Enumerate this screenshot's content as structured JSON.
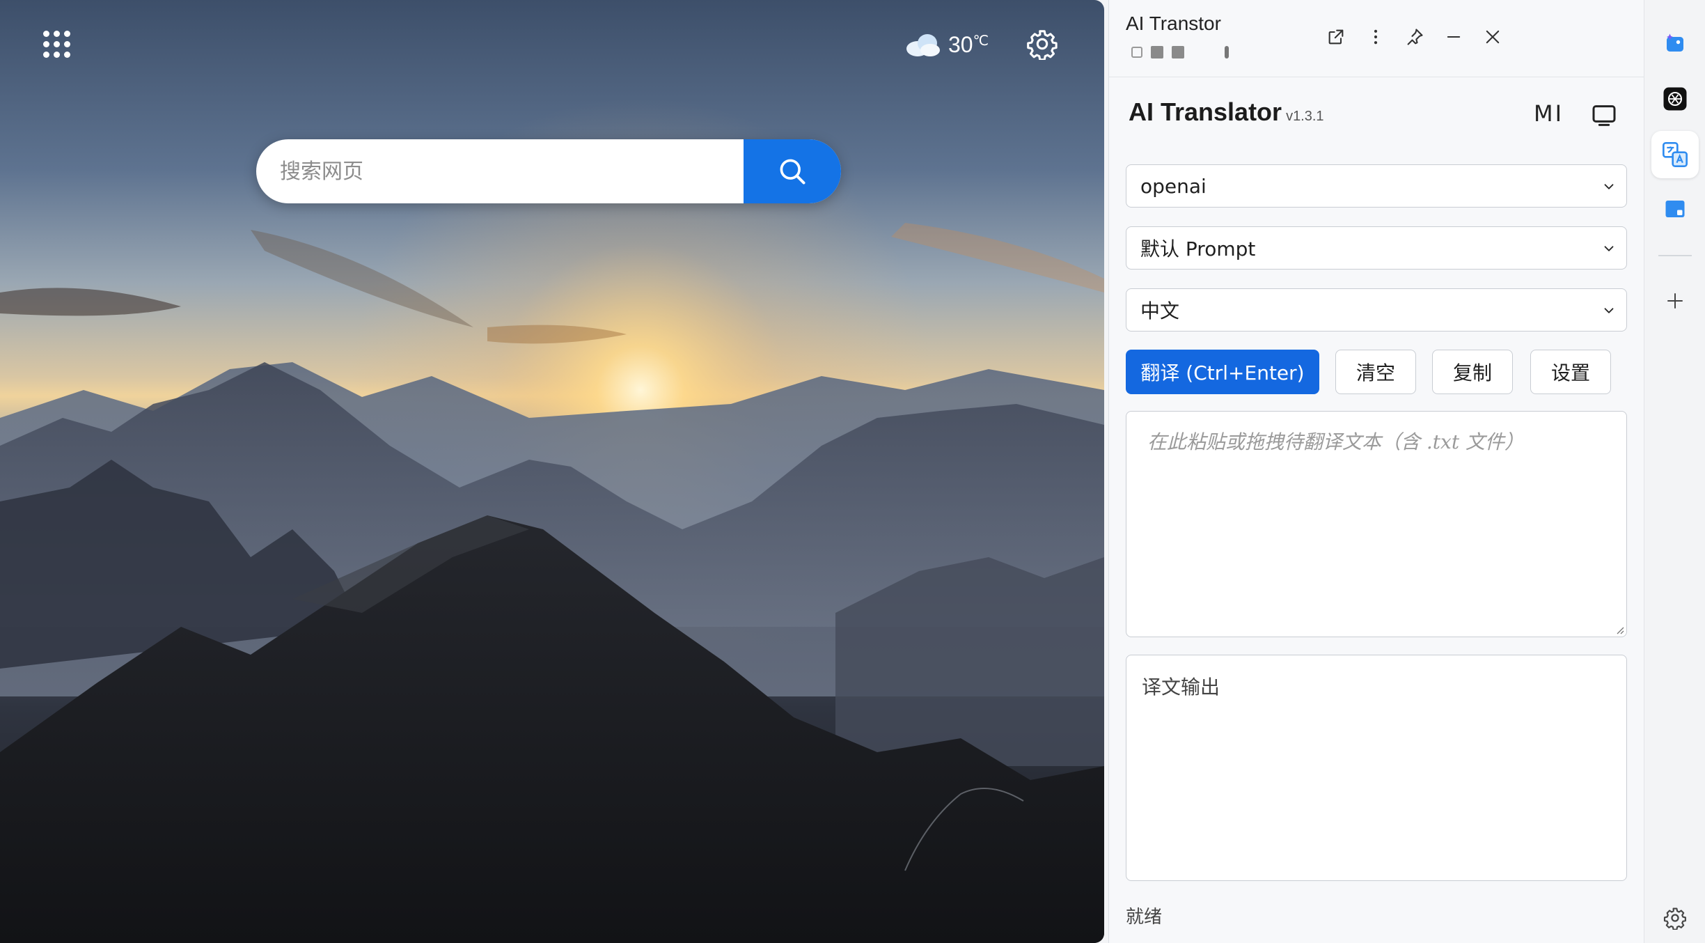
{
  "newtab": {
    "weather": {
      "icon": "cloud-icon",
      "temperature": "30",
      "unit": "℃"
    },
    "search": {
      "placeholder": "搜索网页"
    }
  },
  "panel": {
    "window_title": "AI Transtor",
    "app_title": "AI Translator",
    "app_version": "v1.3.1",
    "mi_label": "MI",
    "provider_select": "openai",
    "prompt_select": "默认 Prompt",
    "language_select": "中文",
    "buttons": {
      "translate": "翻译 (Ctrl+Enter)",
      "clear": "清空",
      "copy": "复制",
      "settings": "设置"
    },
    "input_placeholder": "在此粘贴或拖拽待翻译文本（含 .txt 文件）",
    "output_placeholder": "译文输出",
    "status": "就绪"
  },
  "colors": {
    "accent": "#1468e0",
    "search_button": "#1473e6"
  }
}
